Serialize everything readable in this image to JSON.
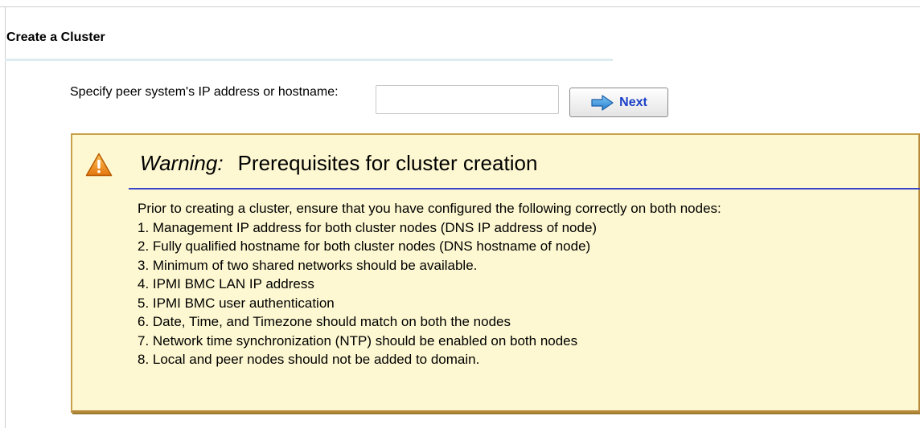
{
  "section": {
    "title": "Create a Cluster"
  },
  "peer": {
    "label": "Specify peer system's IP address or hostname:",
    "input_value": "",
    "next_label": "Next"
  },
  "warning": {
    "label": "Warning:",
    "title": "Prerequisites for cluster creation",
    "intro": "Prior to creating a cluster, ensure that you have configured the following correctly on both nodes:",
    "items": [
      "1. Management IP address for both cluster nodes (DNS IP address of node)",
      "2. Fully qualified hostname for both cluster nodes (DNS hostname of node)",
      "3. Minimum of two shared networks should be available.",
      "4. IPMI BMC LAN IP address",
      "5. IPMI BMC user authentication",
      "6. Date, Time, and Timezone should match on both the nodes",
      "7. Network time synchronization (NTP) should be enabled on both nodes",
      "8. Local and peer nodes should not be added to domain."
    ]
  },
  "colors": {
    "accent_blue": "#1a3fc8",
    "warning_background": "#fdf8d1",
    "warning_border": "#c8a24a",
    "warning_rule": "#3a44c8",
    "section_rule": "#dcecef"
  },
  "icons": {
    "warning": "warning-triangle-icon",
    "next": "right-arrow-icon"
  }
}
